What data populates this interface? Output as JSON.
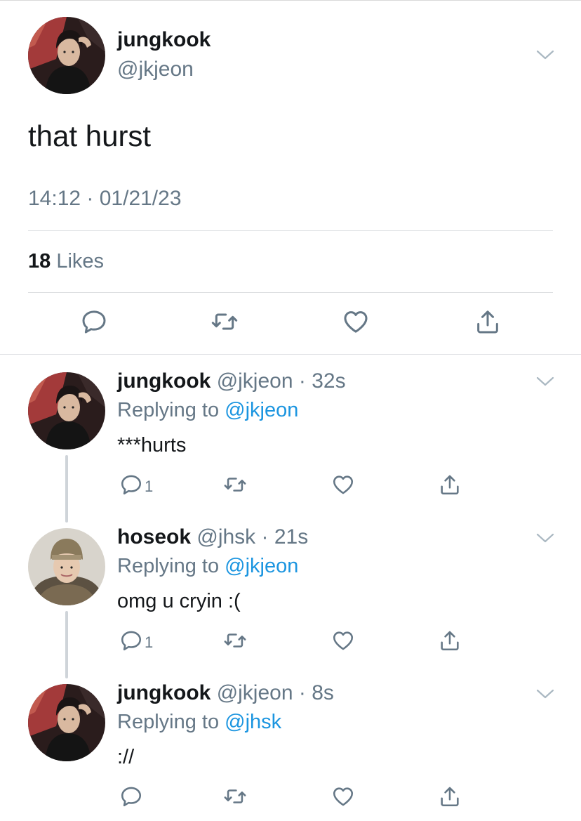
{
  "main_tweet": {
    "name": "jungkook",
    "handle": "@jkjeon",
    "text": "that hurst",
    "timestamp": "14:12 · 01/21/23",
    "likes_count": "18",
    "likes_label": "Likes"
  },
  "replies": [
    {
      "name": "jungkook",
      "handle": "@jkjeon",
      "age": "32s",
      "replying_prefix": "Replying to",
      "replying_to": "@jkjeon",
      "text": "***hurts",
      "reply_count": "1"
    },
    {
      "name": "hoseok",
      "handle": "@jhsk",
      "age": "21s",
      "replying_prefix": "Replying to",
      "replying_to": "@jkjeon",
      "text": "omg u cryin :(",
      "reply_count": "1"
    },
    {
      "name": "jungkook",
      "handle": "@jkjeon",
      "age": "8s",
      "replying_prefix": "Replying to",
      "replying_to": "@jhsk",
      "text": "://",
      "reply_count": ""
    }
  ],
  "colors": {
    "text": "#14171a",
    "secondary": "#657786",
    "link": "#1b95e0",
    "divider": "#dddfe2"
  },
  "icons": [
    "chevron-down-icon",
    "reply-icon",
    "retweet-icon",
    "like-icon",
    "share-icon"
  ]
}
